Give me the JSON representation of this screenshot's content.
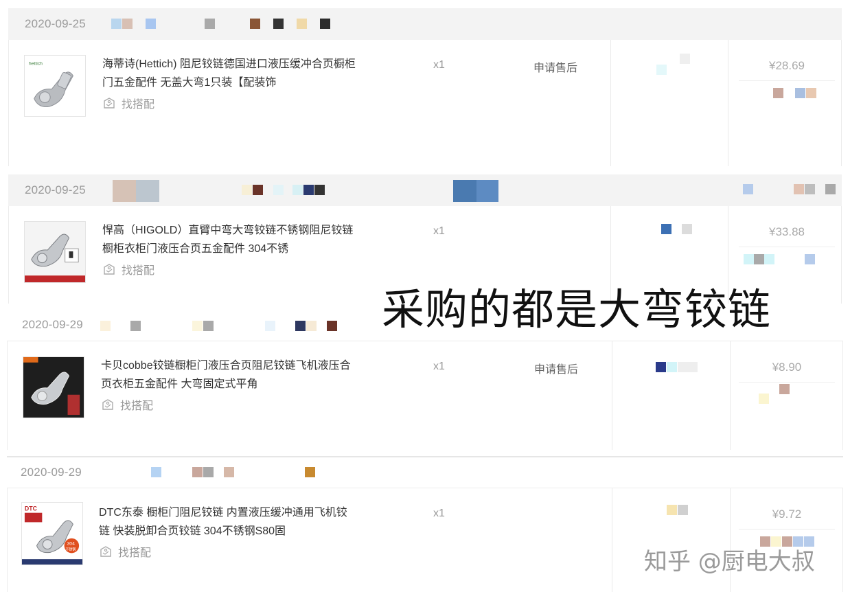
{
  "orders": [
    {
      "date": "2020-09-25",
      "title": "海蒂诗(Hettich) 阻尼铰链德国进口液压缓冲合页橱柜门五金配件 无盖大弯1只装【配装饰",
      "match_label": "找搭配",
      "quantity": "x1",
      "after_sale": "申请售后",
      "price": "¥28.69"
    },
    {
      "date": "2020-09-25",
      "title": "悍高（HIGOLD）直臂中弯大弯铰链不锈钢阻尼铰链橱柜衣柜门液压合页五金配件 304不锈",
      "match_label": "找搭配",
      "quantity": "x1",
      "after_sale": "",
      "price": "¥33.88"
    },
    {
      "date": "2020-09-29",
      "title": "卡贝cobbe铰链橱柜门液压合页阻尼铰链飞机液压合页衣柜五金配件 大弯固定式平角",
      "match_label": "找搭配",
      "quantity": "x1",
      "after_sale": "申请售后",
      "price": "¥8.90"
    },
    {
      "date": "2020-09-29",
      "title": "DTC东泰 橱柜门阻尼铰链 内置液压缓冲通用飞机铰链 快装脱卸合页铰链 304不锈钢S80固",
      "match_label": "找搭配",
      "quantity": "x1",
      "after_sale": "",
      "price": "¥9.72"
    }
  ],
  "overlay_caption": "采购的都是大弯铰链",
  "watermark": "知乎 @厨电大叔",
  "thumb_labels": {
    "hettich": "hettich",
    "dtc_brand": "DTC",
    "dtc_badge": "304",
    "dtc_badge2": "不锈钢"
  },
  "icons": {
    "match": "tag-icon"
  },
  "colors": {
    "header_bg": "#f3f3f3",
    "date_text": "#9a9a9a",
    "price_text": "#aaaaaa",
    "title_text": "#333333"
  }
}
